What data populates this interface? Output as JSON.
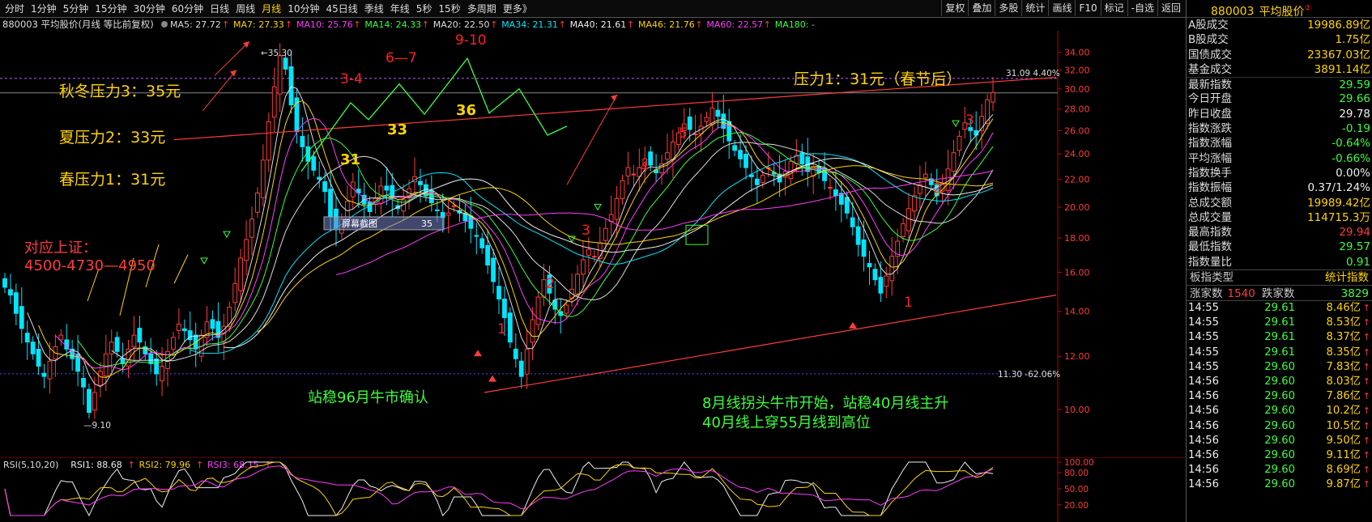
{
  "toolbar": {
    "left": [
      "分时",
      "1分钟",
      "5分钟",
      "15分钟",
      "30分钟",
      "60分钟",
      "日线",
      "周线",
      "月线",
      "10分钟",
      "45日线",
      "季线",
      "年线",
      "5秒",
      "15秒",
      "多周期",
      "更多》"
    ],
    "active_index": 8,
    "right": [
      "复权",
      "叠加",
      "多股",
      "统计",
      "画线",
      "F10",
      "标记",
      "-自选",
      "返回"
    ]
  },
  "chart_header": {
    "title": "880003 平均股价(月线 等比前复权)",
    "ma_items": [
      {
        "text": "MA5: 27.72",
        "color": "#dddddd",
        "arrow": "↑"
      },
      {
        "text": "MA7: 27.33",
        "color": "#ffd400",
        "arrow": "↑"
      },
      {
        "text": "MA10: 25.76",
        "color": "#ff3cff",
        "arrow": "↑"
      },
      {
        "text": "MA14: 24.33",
        "color": "#3bff3b",
        "arrow": "↑"
      },
      {
        "text": "MA20: 22.50",
        "color": "#dddddd",
        "arrow": "↑"
      },
      {
        "text": "MA34: 21.31",
        "color": "#00e5ff",
        "arrow": "↑"
      },
      {
        "text": "MA40: 21.61",
        "color": "#eeeeee",
        "arrow": "↑"
      },
      {
        "text": "MA46: 21.76",
        "color": "#ffd400",
        "arrow": "↑"
      },
      {
        "text": "MA60: 22.57",
        "color": "#ff3cff",
        "arrow": "↑"
      },
      {
        "text": "MA180: -",
        "color": "#3bff3b",
        "arrow": ""
      }
    ]
  },
  "annotations": {
    "autumn": "秋冬压力3：35元",
    "summer": "夏压力2：33元",
    "spring": "春压力1：31元",
    "sh_label": "对应上证：",
    "sh_range": "4500-4730—4950",
    "pressure_right": "压力1：31元（春节后）",
    "bull_confirm": "站稳96月牛市确认",
    "note_line1": "8月线拐头牛市开始，站稳40月线主升",
    "note_line2": "40月线上穿55月线到高位",
    "screenshot_box": "屏幕截图",
    "screenshot_num": "35",
    "high_label": "35.30",
    "low_label": "9.10",
    "upper_line_label": "31.09 4.40%",
    "lower_line_label": "11.30 -62.06%"
  },
  "chart_data": {
    "type": "candlestick",
    "y_ticks": [
      10.0,
      12.0,
      14.0,
      16.0,
      18.0,
      20.0,
      22.0,
      24.0,
      26.0,
      28.0,
      30.0,
      32.0,
      34.0
    ],
    "ylim": [
      9.0,
      36.0
    ],
    "rsi_ticks": [
      "100.00",
      "80.00",
      "50.00",
      "20.00"
    ],
    "rsi_header": {
      "title": "RSI(5,10,20)",
      "items": [
        {
          "text": "RSI1: 88.68",
          "color": "#eeeeee",
          "arrow": "↑"
        },
        {
          "text": "RSI2: 79.96",
          "color": "#ffd400",
          "arrow": "↑"
        },
        {
          "text": "RSI3: 68.15",
          "color": "#ff3cff",
          "arrow": "↑"
        }
      ]
    },
    "wave_labels_red": [
      "3-4",
      "6—7",
      "9-10",
      "5",
      "4",
      "3",
      "2",
      "1",
      "3",
      "2",
      "1"
    ],
    "wave_labels_yellow": [
      "31",
      "33",
      "36"
    ],
    "closes": [
      15.2,
      14.8,
      13.9,
      13.2,
      12.6,
      12.1,
      11.6,
      11.2,
      11.8,
      12.4,
      12.9,
      12.3,
      11.9,
      11.4,
      10.8,
      9.9,
      10.6,
      11.4,
      12.1,
      12.6,
      12.2,
      11.7,
      12.3,
      12.9,
      12.6,
      12.1,
      11.7,
      11.3,
      11.6,
      12.2,
      12.8,
      13.4,
      13.1,
      12.7,
      12.3,
      12.9,
      13.5,
      13.2,
      12.8,
      13.3,
      14.2,
      15.4,
      16.8,
      17.9,
      19.2,
      21.0,
      23.5,
      26.8,
      30.2,
      33.6,
      32.1,
      28.4,
      25.9,
      24.6,
      23.4,
      22.7,
      22.0,
      21.1,
      19.4,
      18.6,
      19.2,
      20.4,
      21.8,
      21.0,
      20.2,
      19.7,
      20.6,
      21.5,
      21.2,
      20.6,
      19.9,
      20.5,
      21.3,
      22.2,
      21.6,
      20.8,
      20.3,
      19.8,
      19.3,
      19.6,
      20.1,
      19.6,
      19.1,
      18.6,
      18.1,
      17.4,
      16.4,
      15.5,
      14.6,
      13.7,
      12.6,
      11.9,
      11.2,
      12.3,
      13.6,
      14.7,
      15.6,
      14.9,
      14.1,
      13.8,
      14.3,
      15.1,
      15.9,
      16.7,
      17.3,
      16.9,
      17.7,
      18.6,
      19.5,
      20.6,
      21.9,
      22.9,
      22.4,
      22.9,
      23.6,
      23.1,
      22.5,
      23.2,
      24.1,
      25.0,
      25.8,
      26.6,
      26.1,
      25.7,
      26.4,
      27.2,
      28.1,
      27.3,
      26.2,
      25.1,
      24.3,
      23.6,
      22.9,
      22.2,
      21.6,
      22.3,
      22.9,
      22.4,
      21.8,
      22.6,
      23.4,
      23.9,
      23.2,
      22.6,
      23.0,
      22.5,
      21.9,
      21.4,
      20.8,
      20.2,
      19.6,
      18.7,
      17.6,
      16.9,
      16.3,
      15.6,
      14.9,
      15.8,
      16.9,
      17.8,
      18.9,
      19.9,
      20.8,
      21.6,
      22.4,
      21.6,
      20.8,
      21.7,
      22.8,
      24.1,
      25.5,
      26.7,
      26.0,
      25.6,
      27.3,
      28.9,
      29.6
    ]
  },
  "sidebar": {
    "code": "880003",
    "name": "平均股价",
    "sup": "②",
    "rows": [
      {
        "label": "A股成交",
        "value": "19986.89亿",
        "color": "val-yellow"
      },
      {
        "label": "B股成交",
        "value": "1.75亿",
        "color": "val-yellow"
      },
      {
        "label": "国债成交",
        "value": "23367.03亿",
        "color": "val-yellow"
      },
      {
        "label": "基金成交",
        "value": "3891.14亿",
        "color": "val-yellow"
      },
      {
        "label": "最新指数",
        "value": "29.59",
        "color": "val-green",
        "sep": true
      },
      {
        "label": "今日开盘",
        "value": "29.66",
        "color": "val-green"
      },
      {
        "label": "昨日收盘",
        "value": "29.78",
        "color": "val-white"
      },
      {
        "label": "指数涨跌",
        "value": "-0.19",
        "color": "val-green"
      },
      {
        "label": "指数涨幅",
        "value": "-0.64%",
        "color": "val-green"
      },
      {
        "label": "平均涨幅",
        "value": "-0.66%",
        "color": "val-green"
      },
      {
        "label": "指数换手",
        "value": "0.00%",
        "color": "val-white"
      },
      {
        "label": "指数振幅",
        "value": "0.37/1.24%",
        "color": "val-white"
      },
      {
        "label": "总成交额",
        "value": "19989.42亿",
        "color": "val-yellow"
      },
      {
        "label": "总成交量",
        "value": "114715.3万",
        "color": "val-yellow"
      },
      {
        "label": "最高指数",
        "value": "29.94",
        "color": "val-red"
      },
      {
        "label": "最低指数",
        "value": "29.57",
        "color": "val-green"
      },
      {
        "label": "指数量比",
        "value": "0.91",
        "color": "val-green"
      }
    ],
    "type_label": "板指类型",
    "type_value": "统计指数",
    "up_label": "涨家数",
    "up_value": "1540",
    "down_label": "跌家数",
    "down_value": "3829",
    "ticks": [
      {
        "time": "14:55",
        "price": "29.61",
        "vol": "8.46亿"
      },
      {
        "time": "14:55",
        "price": "29.61",
        "vol": "8.53亿"
      },
      {
        "time": "14:55",
        "price": "29.61",
        "vol": "8.37亿"
      },
      {
        "time": "14:55",
        "price": "29.61",
        "vol": "8.35亿"
      },
      {
        "time": "14:55",
        "price": "29.60",
        "vol": "7.83亿"
      },
      {
        "time": "14:56",
        "price": "29.60",
        "vol": "8.03亿"
      },
      {
        "time": "14:56",
        "price": "29.60",
        "vol": "7.86亿"
      },
      {
        "time": "14:56",
        "price": "29.60",
        "vol": "10.2亿"
      },
      {
        "time": "14:56",
        "price": "29.60",
        "vol": "10.5亿"
      },
      {
        "time": "14:56",
        "price": "29.60",
        "vol": "9.50亿"
      },
      {
        "time": "14:56",
        "price": "29.60",
        "vol": "9.11亿"
      },
      {
        "time": "14:56",
        "price": "29.60",
        "vol": "8.69亿"
      },
      {
        "time": "14:56",
        "price": "29.60",
        "vol": "9.87亿"
      }
    ]
  }
}
